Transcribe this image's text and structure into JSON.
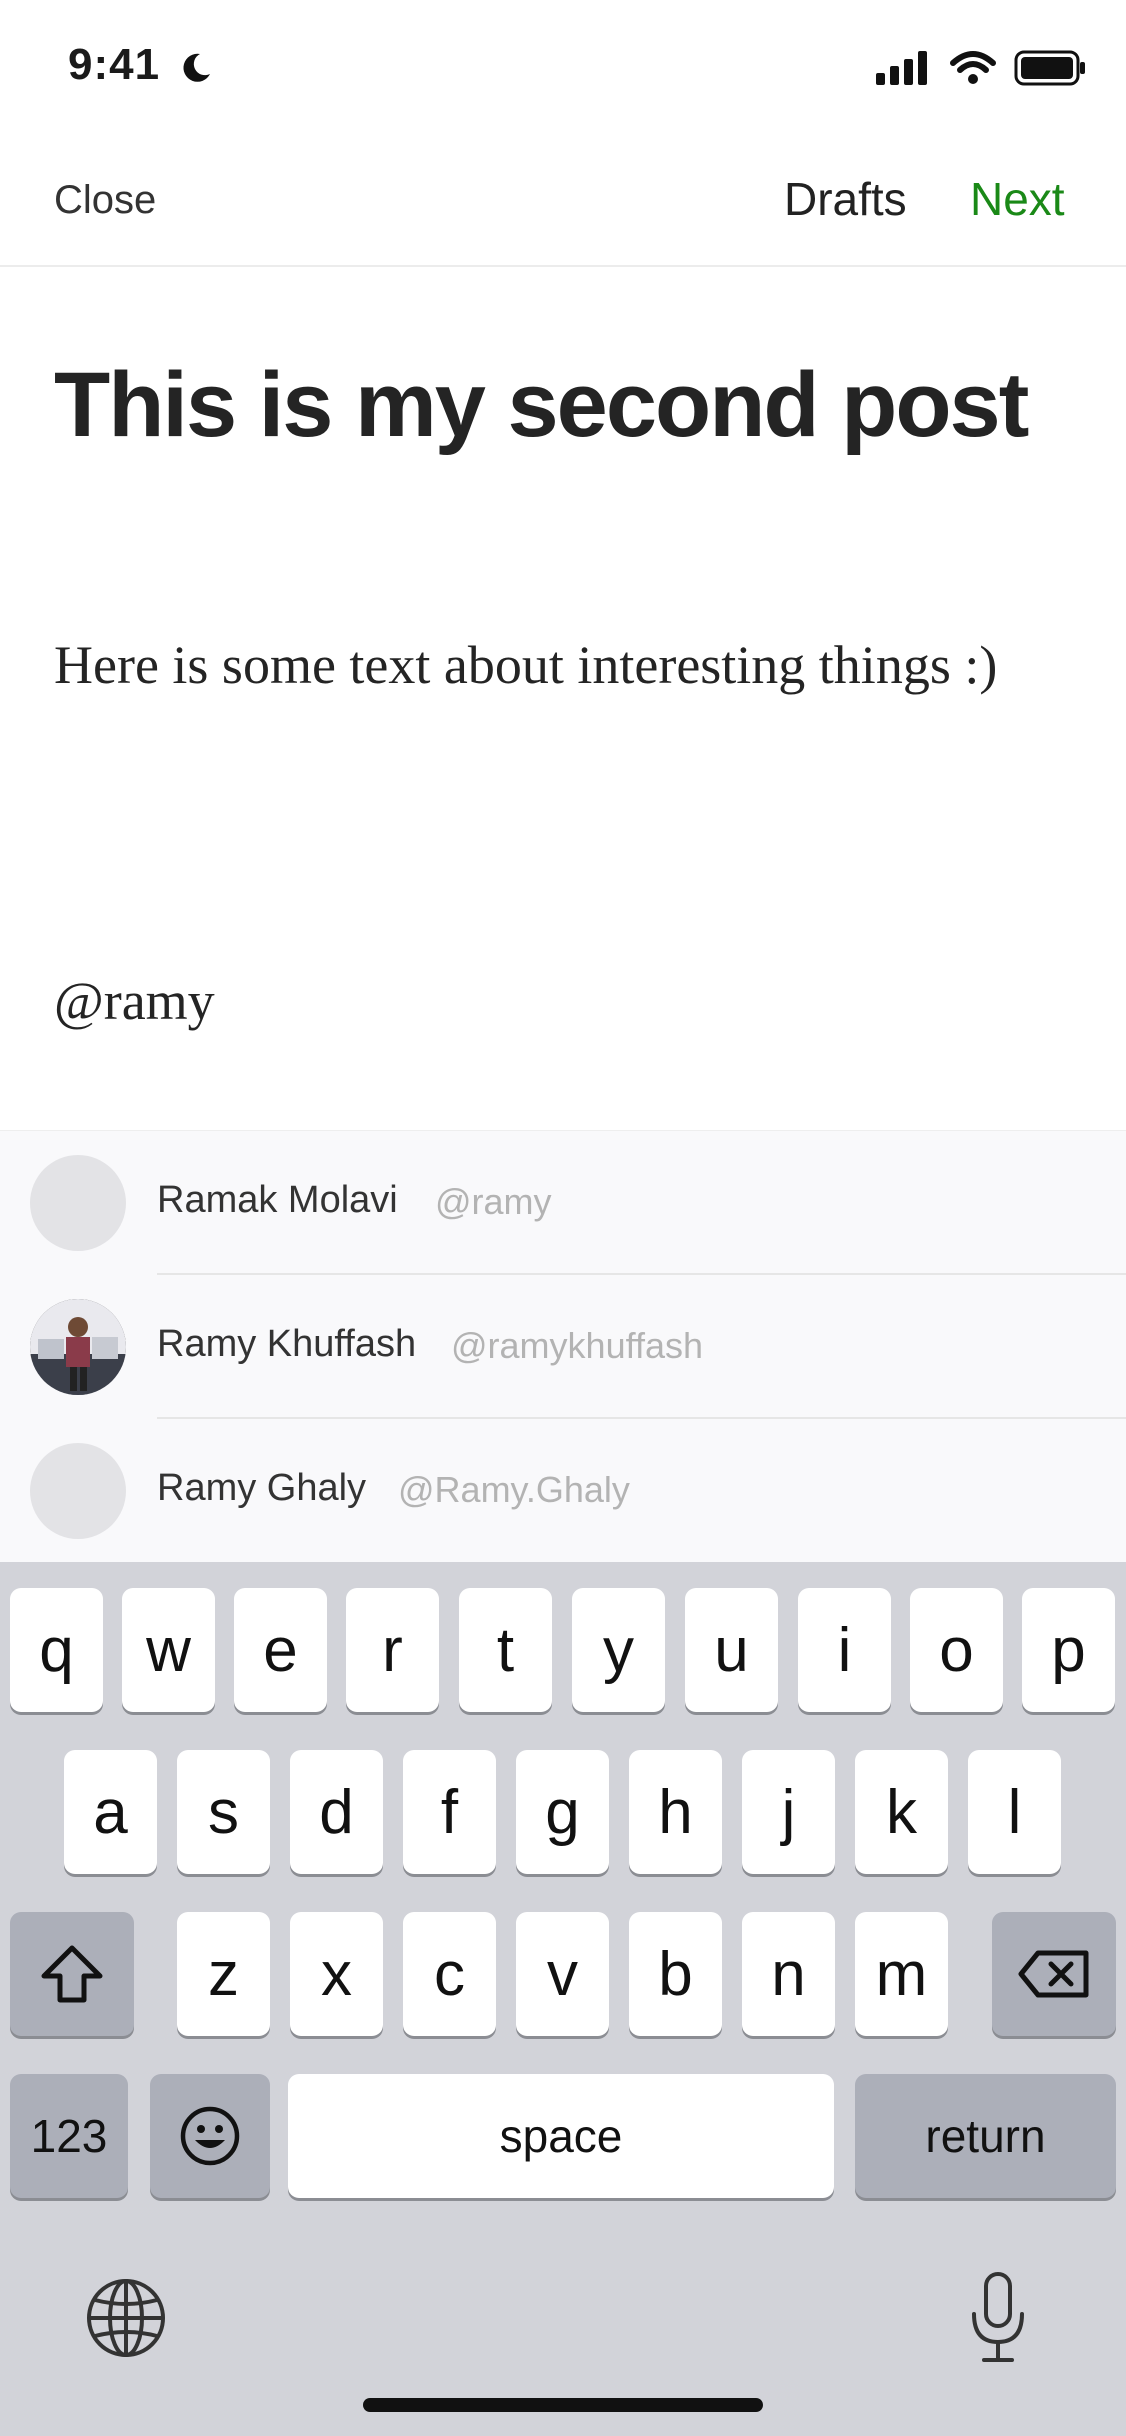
{
  "status": {
    "time": "9:41"
  },
  "nav": {
    "close": "Close",
    "drafts": "Drafts",
    "next": "Next"
  },
  "editor": {
    "title": "This is my second post",
    "body": "Here is some text about interesting things :)",
    "mention": "@ramy"
  },
  "suggestions": [
    {
      "name": "Ramak Molavi",
      "handle": "@ramy",
      "avatar": "placeholder"
    },
    {
      "name": "Ramy Khuffash",
      "handle": "@ramykhuffash",
      "avatar": "photo"
    },
    {
      "name": "Ramy Ghaly",
      "handle": "@Ramy.Ghaly",
      "avatar": "placeholder"
    }
  ],
  "keyboard": {
    "row1": [
      "q",
      "w",
      "e",
      "r",
      "t",
      "y",
      "u",
      "i",
      "o",
      "p"
    ],
    "row2": [
      "a",
      "s",
      "d",
      "f",
      "g",
      "h",
      "j",
      "k",
      "l"
    ],
    "row3": [
      "z",
      "x",
      "c",
      "v",
      "b",
      "n",
      "m"
    ],
    "numbers": "123",
    "space": "space",
    "return": "return"
  },
  "colors": {
    "accent": "#1a8917",
    "keyboard_bg": "#d2d3d9"
  }
}
